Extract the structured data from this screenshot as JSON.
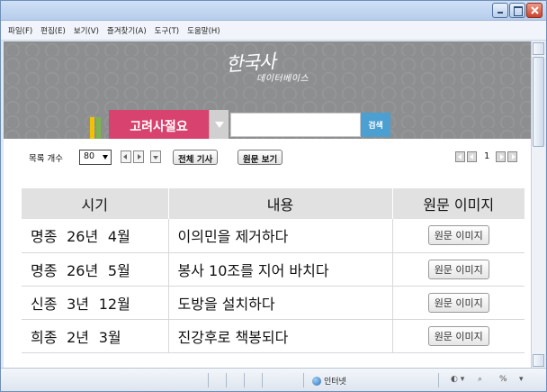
{
  "window": {
    "controls": [
      "minimize-icon",
      "maximize-icon",
      "close-icon"
    ]
  },
  "menu": [
    "파일(F)",
    "편집(E)",
    "보기(V)",
    "즐겨찾기(A)",
    "도구(T)",
    "도움말(H)"
  ],
  "banner": {
    "logo_main": "한국사",
    "logo_sub": "데이터베이스",
    "book_tab": "고려사절요",
    "search_placeholder": "",
    "search_button": "검색",
    "accent_colors": [
      "#d7426f",
      "#4c9fd1",
      "#f2c200",
      "#7ab648"
    ]
  },
  "controls": {
    "count_label": "목록 개수",
    "count_value": "80",
    "all_articles": "전체 기사",
    "original_view": "원문 보기",
    "page_number": "1"
  },
  "table": {
    "headers": [
      "시기",
      "내용",
      "원문 이미지"
    ],
    "rows": [
      {
        "date": "명종 26년 4월",
        "content": "이의민을 제거하다",
        "image": "원문 이미지"
      },
      {
        "date": "명종 26년 5월",
        "content": "봉사 10조를 지어 바치다",
        "image": "원문 이미지"
      },
      {
        "date": "신종 3년 12월",
        "content": "도방을 설치하다",
        "image": "원문 이미지"
      },
      {
        "date": "희종 2년 3월",
        "content": "진강후로 책봉되다",
        "image": "원문 이미지"
      }
    ]
  },
  "status": {
    "zone": "인터넷",
    "zoom": "%"
  }
}
